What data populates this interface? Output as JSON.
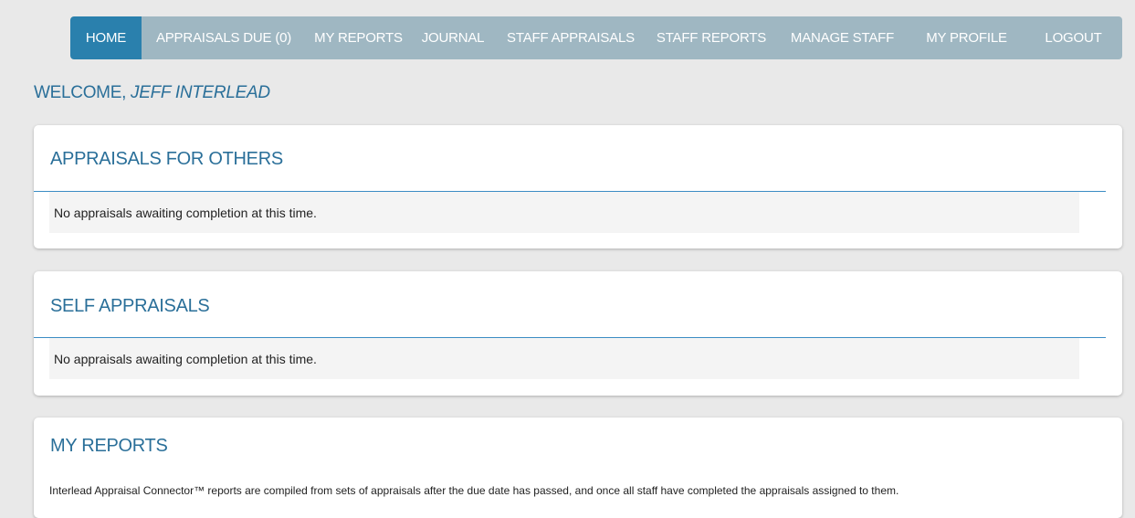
{
  "nav": {
    "items": [
      {
        "label": "HOME",
        "active": true
      },
      {
        "label": "APPRAISALS DUE (0)",
        "active": false
      },
      {
        "label": "MY REPORTS",
        "active": false
      },
      {
        "label": "JOURNAL",
        "active": false
      },
      {
        "label": "STAFF APPRAISALS",
        "active": false
      },
      {
        "label": "STAFF REPORTS",
        "active": false
      },
      {
        "label": "MANAGE STAFF",
        "active": false
      },
      {
        "label": "MY PROFILE",
        "active": false
      },
      {
        "label": "LOGOUT",
        "active": false
      }
    ]
  },
  "welcome": {
    "prefix": "WELCOME, ",
    "user_name": "JEFF INTERLEAD"
  },
  "panels": {
    "others": {
      "title": "APPRAISALS FOR OTHERS",
      "message": "No appraisals awaiting completion at this time."
    },
    "self": {
      "title": "SELF APPRAISALS",
      "message": "No appraisals awaiting completion at this time."
    },
    "reports": {
      "title": "MY REPORTS",
      "description": "Interlead Appraisal Connector™ reports are compiled from sets of appraisals after the due date has passed, and once all staff have completed the appraisals assigned to them."
    }
  },
  "colors": {
    "nav_bg": "#9fb7c2",
    "nav_active": "#2a80ad",
    "heading": "#2a6f99",
    "rule": "#3b8cc4"
  }
}
